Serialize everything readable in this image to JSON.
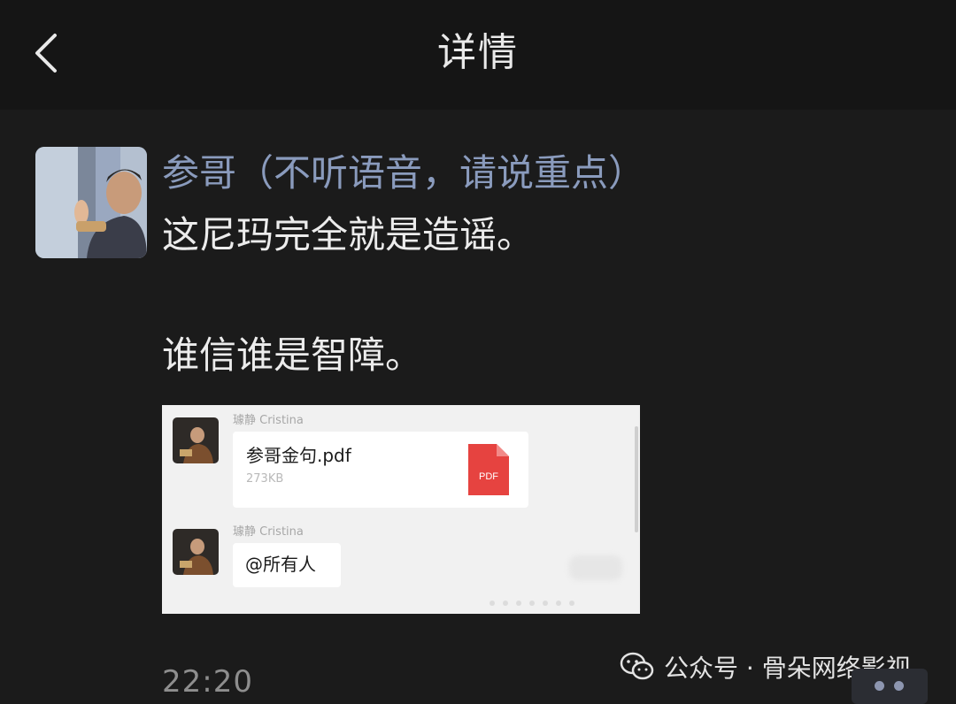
{
  "header": {
    "title": "详情",
    "back_icon": "chevron-left-icon"
  },
  "post": {
    "sender": "参哥（不听语音，请说重点）",
    "line1": "这尼玛完全就是造谣。",
    "line2": "谁信谁是智障。",
    "time": "22:20",
    "sender_color": "#8a9bbd"
  },
  "embedded_screenshot": {
    "messages": [
      {
        "sender": "璩静 Cristina",
        "file_name": "参哥金句.pdf",
        "file_size": "273KB",
        "file_badge": "PDF",
        "icon": "pdf-file-icon",
        "badge_color": "#e64340"
      },
      {
        "sender": "璩静 Cristina",
        "text": "@所有人"
      }
    ]
  },
  "watermark": {
    "text": "公众号 · 骨朵网络影视",
    "icon": "wechat-icon"
  },
  "more_icon": "more-dots-icon"
}
